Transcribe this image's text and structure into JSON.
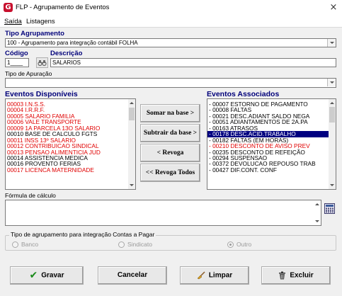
{
  "window": {
    "app_icon": "G",
    "title": "FLP - Agrupamento de Eventos",
    "close_icon": "×"
  },
  "menu": {
    "items": [
      {
        "label": "Saída"
      },
      {
        "label": "Listagens"
      }
    ]
  },
  "tipo_agrupamento": {
    "label": "Tipo Agrupamento",
    "value": "100 - Agrupamento para integração contábil FOLHA"
  },
  "codigo": {
    "label": "Código",
    "value": "1____",
    "lookup_icon": "binoculars-icon"
  },
  "descricao": {
    "label": "Descrição",
    "value": "SALARIOS"
  },
  "tipo_apuracao": {
    "label": "Tipo de Apuração",
    "value": ""
  },
  "disponiveis": {
    "label": "Eventos Disponíveis",
    "items": [
      {
        "text": "00003 I.N.S.S.",
        "color": "red"
      },
      {
        "text": "00004 I.R.R.F.",
        "color": "red"
      },
      {
        "text": "00005 SALARIO FAMILIA",
        "color": "red"
      },
      {
        "text": "00006 VALE TRANSPORTE",
        "color": "red"
      },
      {
        "text": "00009 1A PARCELA 13O SALARIO",
        "color": "red"
      },
      {
        "text": "00010 BASE DE CALCULO FGTS",
        "color": "black"
      },
      {
        "text": "00011 INSS 13º SALARIO",
        "color": "red"
      },
      {
        "text": "00012 CONTRIBUICAO SINDICAL",
        "color": "red"
      },
      {
        "text": "00013 PENSAO ALIMENTICIA JUD",
        "color": "red"
      },
      {
        "text": "00014 ASSISTENCIA MEDICA",
        "color": "black"
      },
      {
        "text": "00016 PROVENTO FERIAS",
        "color": "black"
      },
      {
        "text": "00017 LICENCA MATERNIDADE",
        "color": "red"
      }
    ]
  },
  "buttons": {
    "somar": "Somar na base >",
    "subtrair": "Subtrair da base >",
    "revoga": "< Revoga",
    "revoga_todos": "<< Revoga Todos"
  },
  "associados": {
    "label": "Eventos Associados",
    "items": [
      {
        "text": "- 00007 ESTORNO DE PAGAMENTO",
        "color": "black"
      },
      {
        "text": "- 00008 FALTAS",
        "color": "black"
      },
      {
        "text": "- 00021 DESC.ADIANT SALDO NEGA",
        "color": "black"
      },
      {
        "text": "- 00051 ADIANTAMENTOS DE 2A.PA",
        "color": "black"
      },
      {
        "text": "- 00163 ATRASOS",
        "color": "black"
      },
      {
        "text": "- 00178 DESC.ACID.TRABALHO",
        "color": "selected"
      },
      {
        "text": "- 00182 FALTAS (EM HORAS)",
        "color": "black"
      },
      {
        "text": "- 00210 DESCONTO DE AVISO PREV",
        "color": "red"
      },
      {
        "text": "- 00235 DESCONTO DE REFEIÇÃO",
        "color": "black"
      },
      {
        "text": "- 00294 SUSPENSAO",
        "color": "black"
      },
      {
        "text": "- 00372 DEVOLUCAO REPOUSO TRAB",
        "color": "black"
      },
      {
        "text": "- 00427 DIF.CONT. CONF",
        "color": "black"
      }
    ]
  },
  "formula": {
    "label": "Fórmula de cálculo",
    "value": "",
    "calc_icon": "calculator-icon"
  },
  "integracao": {
    "legend": "Tipo de agrupamento para integração Contas a Pagar",
    "options": [
      {
        "label": "Banco",
        "selected": false
      },
      {
        "label": "Sindicato",
        "selected": false
      },
      {
        "label": "Outro",
        "selected": true
      }
    ]
  },
  "actions": {
    "gravar": {
      "label": "Gravar",
      "icon": "check-icon"
    },
    "cancelar": {
      "label": "Cancelar"
    },
    "limpar": {
      "label": "Limpar",
      "icon": "broom-icon"
    },
    "excluir": {
      "label": "Excluir",
      "icon": "trash-icon"
    }
  },
  "colors": {
    "label_blue": "#00007a",
    "red_item": "#e00000",
    "selection": "#000080",
    "check_green": "#1a8a1a"
  }
}
